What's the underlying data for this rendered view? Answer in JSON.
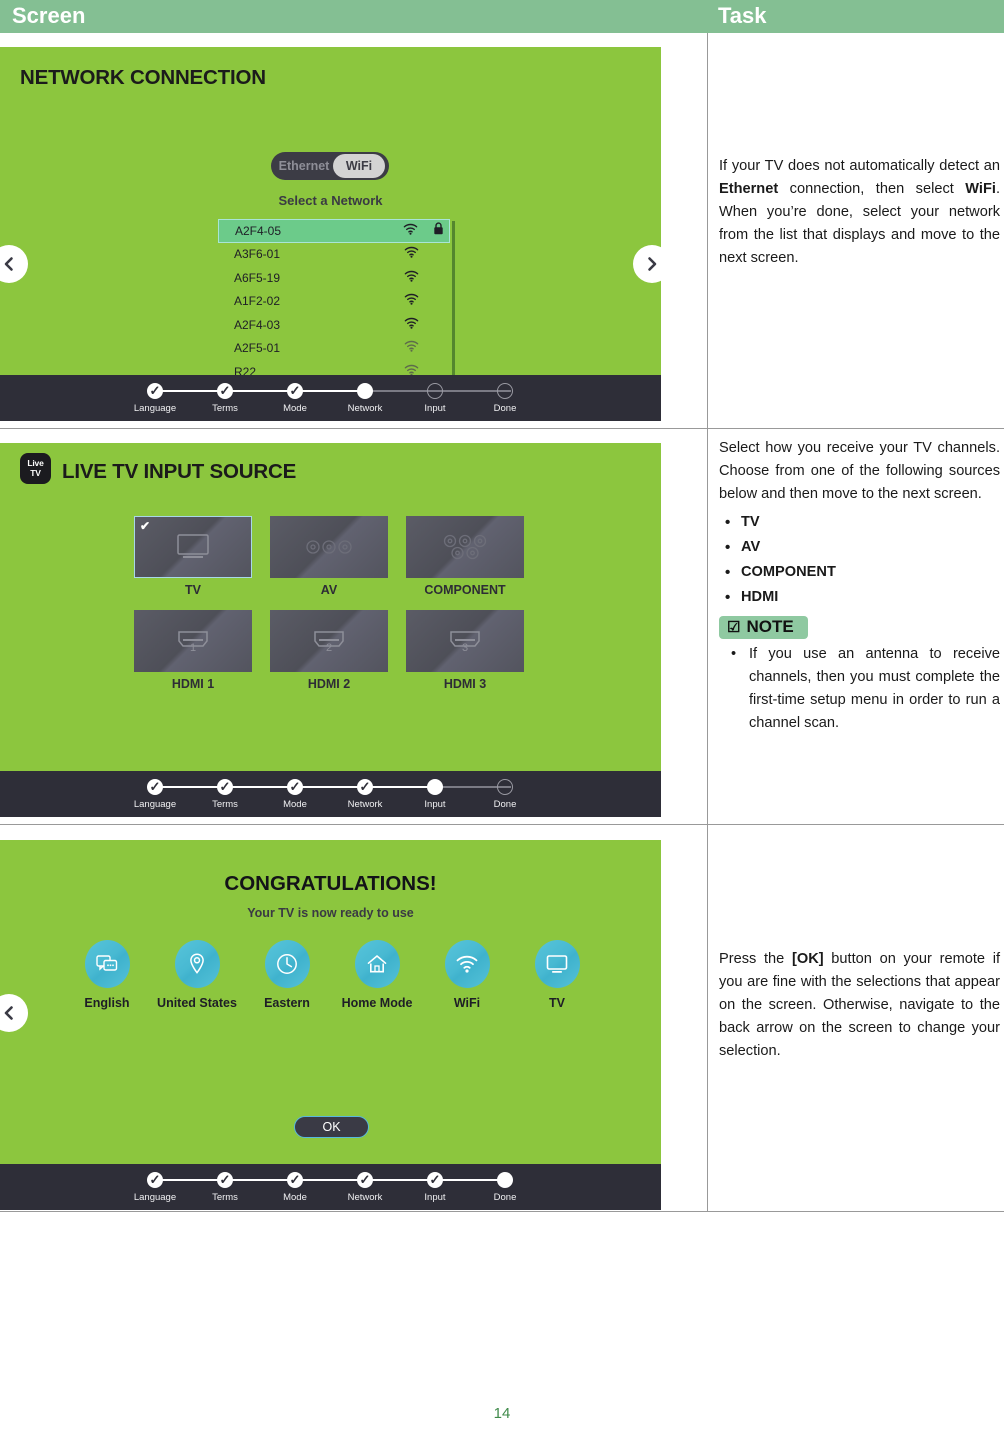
{
  "header": {
    "screen_label": "Screen",
    "task_label": "Task"
  },
  "page_number": "14",
  "colors": {
    "header_green": "#84bf93",
    "tv_green": "#8cc63e",
    "strip_dark": "#2e2e38",
    "accent_teal": "#48b9d2",
    "note_green": "#8fc9a1",
    "page_num_green": "#3f8a4a"
  },
  "stepper_labels": [
    "Language",
    "Terms",
    "Mode",
    "Network",
    "Input",
    "Done"
  ],
  "screens": [
    {
      "id": "network-connection",
      "title": "NETWORK CONNECTION",
      "toggle": {
        "left_label": "Ethernet",
        "right_label": "WiFi",
        "selected": "WiFi"
      },
      "select_prompt": "Select a Network",
      "networks": [
        {
          "ssid": "A2F4-05",
          "secured": true,
          "selected": true
        },
        {
          "ssid": "A3F6-01",
          "secured": false,
          "selected": false
        },
        {
          "ssid": "A6F5-19",
          "secured": false,
          "selected": false
        },
        {
          "ssid": "A1F2-02",
          "secured": false,
          "selected": false
        },
        {
          "ssid": "A2F4-03",
          "secured": false,
          "selected": false
        },
        {
          "ssid": "A2F5-01",
          "secured": false,
          "selected": false
        },
        {
          "ssid": "R22",
          "secured": false,
          "selected": false
        }
      ],
      "stepper_state": [
        "done",
        "done",
        "done",
        "current",
        "todo",
        "todo"
      ]
    },
    {
      "id": "live-tv-input-source",
      "logo_line1": "Live",
      "logo_line2": "TV",
      "title": "LIVE TV INPUT SOURCE",
      "tiles": [
        {
          "label": "TV",
          "icon": "tv-icon",
          "selected": true
        },
        {
          "label": "AV",
          "icon": "av-jacks-icon",
          "selected": false
        },
        {
          "label": "COMPONENT",
          "icon": "component-jacks-icon",
          "selected": false
        },
        {
          "label": "HDMI 1",
          "icon": "hdmi-port-icon",
          "selected": false,
          "port": "1"
        },
        {
          "label": "HDMI 2",
          "icon": "hdmi-port-icon",
          "selected": false,
          "port": "2"
        },
        {
          "label": "HDMI 3",
          "icon": "hdmi-port-icon",
          "selected": false,
          "port": "3"
        }
      ],
      "stepper_state": [
        "done",
        "done",
        "done",
        "done",
        "current",
        "todo"
      ]
    },
    {
      "id": "congratulations",
      "title": "CONGRATULATIONS!",
      "subtitle": "Your TV is now ready to use",
      "summary": [
        {
          "label": "English",
          "icon": "language-icon"
        },
        {
          "label": "United States",
          "icon": "location-pin-icon"
        },
        {
          "label": "Eastern",
          "icon": "clock-icon"
        },
        {
          "label": "Home Mode",
          "icon": "home-icon"
        },
        {
          "label": "WiFi",
          "icon": "wifi-icon"
        },
        {
          "label": "TV",
          "icon": "tv-icon"
        }
      ],
      "ok_button": "OK",
      "stepper_state": [
        "done",
        "done",
        "done",
        "done",
        "done",
        "current"
      ]
    }
  ],
  "tasks": [
    {
      "id": "task-network",
      "html": "If your TV does not automatically detect an <b>Ethernet</b> connection, then select <b>WiFi</b>. When you&rsquo;re done, select your network from the list that displays and move to the next screen."
    },
    {
      "id": "task-input-source",
      "html": "Select how you receive your TV channels. Choose from one of the following sources below and then move to the next screen.",
      "bullets": [
        "TV",
        "AV",
        "COMPONENT",
        "HDMI"
      ],
      "note_label": "NOTE",
      "note_items": [
        "If you use an antenna to receive channels, then you must complete the first-time setup menu in order to run a channel scan."
      ]
    },
    {
      "id": "task-congratulations",
      "html": "Press the <b>[OK]</b> button on your remote if you are fine with the selections that appear on the screen. Otherwise, navigate to the back arrow on the screen to change your selection."
    }
  ]
}
